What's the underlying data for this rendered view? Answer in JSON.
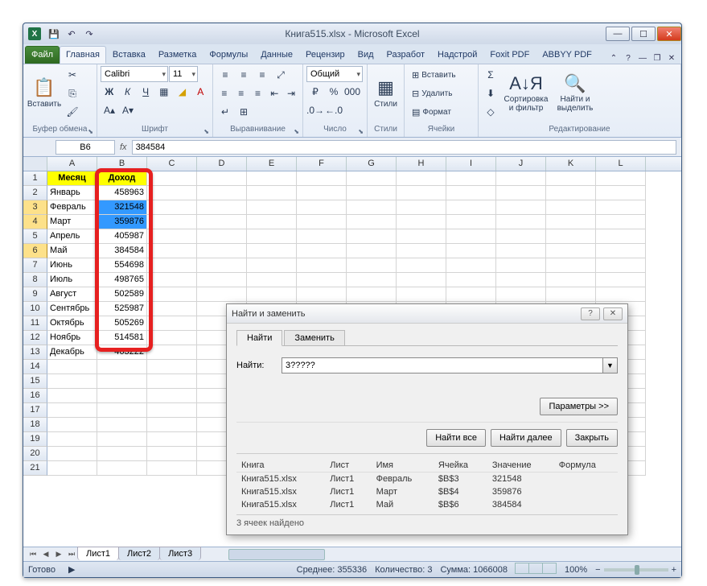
{
  "window": {
    "title": "Книга515.xlsx - Microsoft Excel",
    "excel_glyph": "X"
  },
  "qat": {
    "save": "💾",
    "undo": "↶",
    "redo": "↷"
  },
  "tabs": {
    "file": "Файл",
    "home": "Главная",
    "insert": "Вставка",
    "layout": "Разметка",
    "formulas": "Формулы",
    "data": "Данные",
    "review": "Рецензир",
    "view": "Вид",
    "developer": "Разработ",
    "addins": "Надстрой",
    "foxit": "Foxit PDF",
    "abbyy": "ABBYY PDF"
  },
  "ribbon": {
    "clipboard": {
      "paste": "Вставить",
      "label": "Буфер обмена"
    },
    "font": {
      "name": "Calibri",
      "size": "11",
      "label": "Шрифт"
    },
    "align": {
      "label": "Выравнивание"
    },
    "number": {
      "format": "Общий",
      "label": "Число"
    },
    "styles": {
      "styles": "Стили",
      "label": "Стили"
    },
    "cells": {
      "insert": "Вставить",
      "delete": "Удалить",
      "format": "Формат",
      "label": "Ячейки"
    },
    "editing": {
      "sort": "Сортировка и фильтр",
      "find": "Найти и выделить",
      "label": "Редактирование"
    }
  },
  "formula_bar": {
    "cell_ref": "B6",
    "fx": "fx",
    "formula": "384584"
  },
  "columns": [
    "A",
    "B",
    "C",
    "D",
    "E",
    "F",
    "G",
    "H",
    "I",
    "J",
    "K",
    "L"
  ],
  "sheet": {
    "header": {
      "a": "Месяц",
      "b": "Доход"
    },
    "rows": [
      {
        "n": 1,
        "a": "Месяц",
        "b": "Доход",
        "hdr": true
      },
      {
        "n": 2,
        "a": "Январь",
        "b": "458963"
      },
      {
        "n": 3,
        "a": "Февраль",
        "b": "321548",
        "sel": true
      },
      {
        "n": 4,
        "a": "Март",
        "b": "359876",
        "sel": true
      },
      {
        "n": 5,
        "a": "Апрель",
        "b": "405987"
      },
      {
        "n": 6,
        "a": "Май",
        "b": "384584",
        "sel": true,
        "active": true
      },
      {
        "n": 7,
        "a": "Июнь",
        "b": "554698"
      },
      {
        "n": 8,
        "a": "Июль",
        "b": "498765"
      },
      {
        "n": 9,
        "a": "Август",
        "b": "502589"
      },
      {
        "n": 10,
        "a": "Сентябрь",
        "b": "525987"
      },
      {
        "n": 11,
        "a": "Октябрь",
        "b": "505269"
      },
      {
        "n": 12,
        "a": "Ноябрь",
        "b": "514581"
      },
      {
        "n": 13,
        "a": "Декабрь",
        "b": "463222"
      }
    ],
    "blank_rows": [
      14,
      15,
      16,
      17,
      18,
      19,
      20,
      21
    ]
  },
  "sheet_tabs": {
    "s1": "Лист1",
    "s2": "Лист2",
    "s3": "Лист3"
  },
  "status": {
    "ready": "Готово",
    "avg_label": "Среднее:",
    "avg": "355336",
    "count_label": "Количество:",
    "count": "3",
    "sum_label": "Сумма:",
    "sum": "1066008",
    "zoom": "100%"
  },
  "dialog": {
    "title": "Найти и заменить",
    "tab_find": "Найти",
    "tab_replace": "Заменить",
    "label_find": "Найти:",
    "find_value": "3?????",
    "params": "Параметры >>",
    "find_all": "Найти все",
    "find_next": "Найти далее",
    "close": "Закрыть",
    "cols": {
      "book": "Книга",
      "sheet": "Лист",
      "name": "Имя",
      "cell": "Ячейка",
      "value": "Значение",
      "formula": "Формула"
    },
    "results": [
      {
        "book": "Книга515.xlsx",
        "sheet": "Лист1",
        "name": "Февраль",
        "cell": "$B$3",
        "value": "321548"
      },
      {
        "book": "Книга515.xlsx",
        "sheet": "Лист1",
        "name": "Март",
        "cell": "$B$4",
        "value": "359876"
      },
      {
        "book": "Книга515.xlsx",
        "sheet": "Лист1",
        "name": "Май",
        "cell": "$B$6",
        "value": "384584"
      }
    ],
    "summary": "3 ячеек найдено"
  }
}
